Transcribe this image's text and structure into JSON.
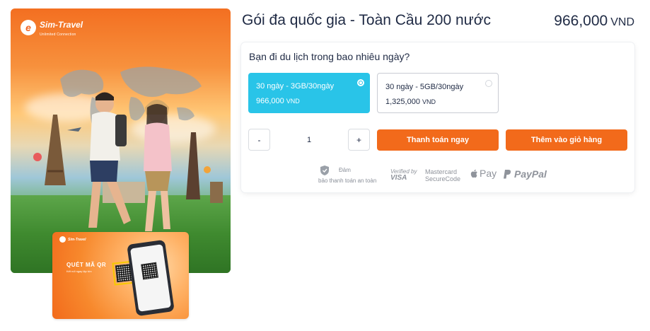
{
  "product": {
    "title": "Gói đa quốc gia - Toàn Cầu 200 nước",
    "price": "966,000",
    "currency": "VND"
  },
  "hero_image": {
    "logo_text": "Sim-Travel",
    "logo_tagline": "Unlimited Connection"
  },
  "promo_card": {
    "logo_text": "Sim-Travel",
    "title": "QUÉT MÃ QR",
    "subtitle": "Kết nối ngay lập tức"
  },
  "plan_selector": {
    "question": "Bạn đi du lịch trong bao nhiêu ngày?",
    "options": [
      {
        "name": "30 ngày - 3GB/30ngày",
        "price": "966,000",
        "currency": "VND",
        "selected": true
      },
      {
        "name": "30 ngày - 5GB/30ngày",
        "price": "1,325,000",
        "currency": "VND",
        "selected": false
      }
    ]
  },
  "quantity": {
    "minus": "-",
    "value": "1",
    "plus": "+"
  },
  "actions": {
    "buy_now": "Thanh toán ngay",
    "add_to_cart": "Thêm vào giỏ hàng"
  },
  "secure_payment": {
    "line1": "Đảm",
    "line2": "bảo thanh toán an toàn",
    "icon": "shield-icon"
  },
  "payment_methods": {
    "visa_top": "Verified by",
    "visa_bottom": "VISA",
    "mastercard_top": "Mastercard",
    "mastercard_bottom": "SecureCode",
    "apple_pay": "Pay",
    "paypal": "PayPal"
  },
  "colors": {
    "accent_orange": "#f26a1b",
    "selected_cyan": "#29c4e8",
    "text_dark": "#1f2a44"
  }
}
